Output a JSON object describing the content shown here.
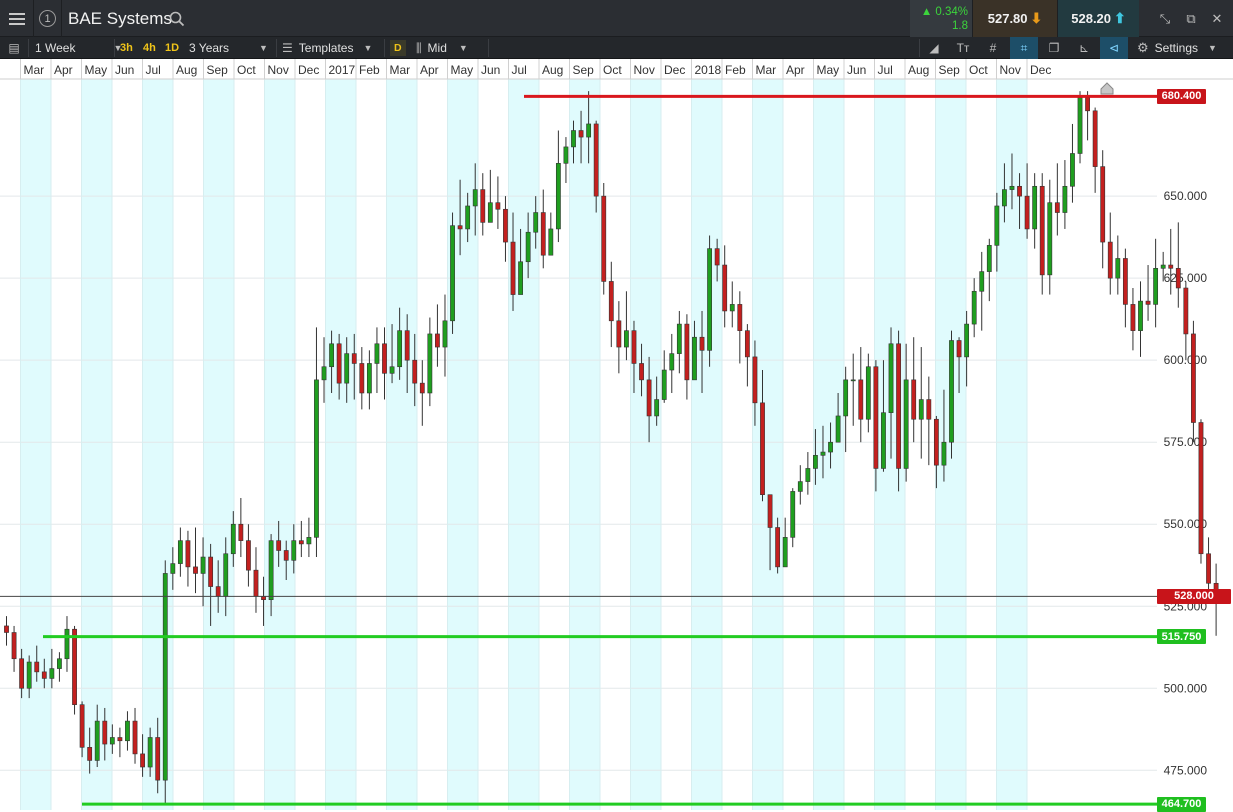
{
  "header": {
    "instrument": "BAE Systems",
    "alert_count": "1",
    "change_pct": "▲ 0.34%",
    "change_abs": "1.8",
    "sell_price": "527.80",
    "buy_price": "528.20"
  },
  "toolbar": {
    "interval": "1 Week",
    "quick_3h": "3h",
    "quick_4h": "4h",
    "quick_1d": "1D",
    "range": "3 Years",
    "templates": "Templates",
    "chart_type_badge": "D",
    "price_type": "Mid",
    "text_tool": "Tт",
    "settings": "Settings"
  },
  "chart_data": {
    "type": "candlestick",
    "x_tick_labels": [
      "Mar",
      "Apr",
      "May",
      "Jun",
      "Jul",
      "Aug",
      "Sep",
      "Oct",
      "Nov",
      "Dec",
      "2017",
      "Feb",
      "Mar",
      "Apr",
      "May",
      "Jun",
      "Jul",
      "Aug",
      "Sep",
      "Oct",
      "Nov",
      "Dec",
      "2018",
      "Feb",
      "Mar",
      "Apr",
      "May",
      "Jun",
      "Jul",
      "Aug",
      "Sep",
      "Oct",
      "Nov",
      "Dec"
    ],
    "y_tick_labels": [
      "650.000",
      "625.000",
      "600.000",
      "575.000",
      "550.000",
      "525.000",
      "500.000",
      "475.000"
    ],
    "y_ticks": [
      650,
      625,
      600,
      575,
      550,
      525,
      500,
      475
    ],
    "ylim": [
      462.9,
      685.7
    ],
    "current_price": 528.0,
    "current_price_label": "528.000",
    "horizontal_lines": [
      {
        "value": 680.4,
        "label": "680.400",
        "color": "#d9171d"
      },
      {
        "value": 515.75,
        "label": "515.750",
        "color": "#22cc22"
      },
      {
        "value": 464.7,
        "label": "464.700",
        "color": "#22cc22"
      }
    ],
    "up_color": "#1f9e1f",
    "down_color": "#c3201f",
    "candles": [
      [
        519,
        517,
        522,
        513
      ],
      [
        517,
        509,
        519,
        505
      ],
      [
        509,
        500,
        512,
        497
      ],
      [
        500,
        508,
        510,
        497
      ],
      [
        508,
        505,
        513,
        502
      ],
      [
        505,
        503,
        509,
        500
      ],
      [
        503,
        506,
        512,
        500
      ],
      [
        506,
        509,
        511,
        502
      ],
      [
        509,
        518,
        522,
        505
      ],
      [
        518,
        495,
        519,
        492
      ],
      [
        495,
        482,
        496,
        479
      ],
      [
        482,
        478,
        488,
        474
      ],
      [
        478,
        490,
        495,
        476
      ],
      [
        490,
        483,
        494,
        478
      ],
      [
        483,
        485,
        489,
        480
      ],
      [
        485,
        484,
        488,
        479
      ],
      [
        484,
        490,
        493,
        481
      ],
      [
        490,
        480,
        494,
        477
      ],
      [
        480,
        476,
        486,
        473
      ],
      [
        476,
        485,
        488,
        473
      ],
      [
        485,
        472,
        491,
        468
      ],
      [
        472,
        535,
        539,
        465
      ],
      [
        535,
        538,
        543,
        530
      ],
      [
        538,
        545,
        549,
        534
      ],
      [
        545,
        537,
        548,
        531
      ],
      [
        537,
        535,
        549,
        529
      ],
      [
        535,
        540,
        546,
        525
      ],
      [
        540,
        531,
        544,
        519
      ],
      [
        531,
        528,
        539,
        523
      ],
      [
        528,
        541,
        546,
        522
      ],
      [
        541,
        550,
        554,
        537
      ],
      [
        550,
        545,
        558,
        540
      ],
      [
        545,
        536,
        550,
        531
      ],
      [
        536,
        528,
        543,
        523
      ],
      [
        528,
        527,
        534,
        519
      ],
      [
        527,
        545,
        547,
        522
      ],
      [
        545,
        542,
        551,
        537
      ],
      [
        542,
        539,
        545,
        533
      ],
      [
        539,
        545,
        550,
        535
      ],
      [
        545,
        544,
        551,
        540
      ],
      [
        544,
        546,
        552,
        540
      ],
      [
        546,
        594,
        610,
        540
      ],
      [
        594,
        598,
        607,
        587
      ],
      [
        598,
        605,
        609,
        590
      ],
      [
        605,
        593,
        608,
        588
      ],
      [
        593,
        602,
        607,
        587
      ],
      [
        602,
        599,
        608,
        588
      ],
      [
        599,
        590,
        604,
        585
      ],
      [
        590,
        599,
        603,
        585
      ],
      [
        599,
        605,
        610,
        590
      ],
      [
        605,
        596,
        610,
        588
      ],
      [
        596,
        598,
        611,
        593
      ],
      [
        598,
        609,
        616,
        594
      ],
      [
        609,
        600,
        614,
        590
      ],
      [
        600,
        593,
        608,
        586
      ],
      [
        593,
        590,
        600,
        580
      ],
      [
        590,
        608,
        613,
        586
      ],
      [
        608,
        604,
        617,
        598
      ],
      [
        604,
        612,
        620,
        595
      ],
      [
        612,
        641,
        645,
        608
      ],
      [
        641,
        640,
        655,
        632
      ],
      [
        640,
        647,
        651,
        636
      ],
      [
        647,
        652,
        660,
        638
      ],
      [
        652,
        642,
        657,
        638
      ],
      [
        642,
        648,
        658,
        643
      ],
      [
        648,
        646,
        656,
        640
      ],
      [
        646,
        636,
        650,
        630
      ],
      [
        636,
        620,
        645,
        615
      ],
      [
        620,
        630,
        640,
        623
      ],
      [
        630,
        639,
        645,
        625
      ],
      [
        639,
        645,
        650,
        634
      ],
      [
        645,
        632,
        652,
        628
      ],
      [
        632,
        640,
        645,
        633
      ],
      [
        640,
        660,
        670,
        636
      ],
      [
        660,
        665,
        668,
        654
      ],
      [
        665,
        670,
        673,
        660
      ],
      [
        670,
        668,
        676,
        660
      ],
      [
        668,
        672,
        682,
        660
      ],
      [
        672,
        650,
        673,
        645
      ],
      [
        650,
        624,
        654,
        620
      ],
      [
        624,
        612,
        630,
        604
      ],
      [
        612,
        604,
        618,
        596
      ],
      [
        604,
        609,
        621,
        600
      ],
      [
        609,
        599,
        612,
        590
      ],
      [
        599,
        594,
        605,
        589
      ],
      [
        594,
        583,
        601,
        575
      ],
      [
        583,
        588,
        595,
        580
      ],
      [
        588,
        597,
        603,
        587
      ],
      [
        597,
        602,
        608,
        590
      ],
      [
        602,
        611,
        615,
        596
      ],
      [
        611,
        594,
        614,
        588
      ],
      [
        594,
        607,
        612,
        596
      ],
      [
        607,
        603,
        615,
        590
      ],
      [
        603,
        634,
        638,
        598
      ],
      [
        634,
        629,
        637,
        624
      ],
      [
        629,
        615,
        635,
        610
      ],
      [
        615,
        617,
        624,
        610
      ],
      [
        617,
        609,
        621,
        599
      ],
      [
        609,
        601,
        611,
        592
      ],
      [
        601,
        587,
        606,
        580
      ],
      [
        587,
        559,
        597,
        557
      ],
      [
        559,
        549,
        552,
        536
      ],
      [
        549,
        537,
        552,
        535
      ],
      [
        537,
        546,
        552,
        540
      ],
      [
        546,
        560,
        561,
        543
      ],
      [
        560,
        563,
        568,
        556
      ],
      [
        563,
        567,
        572,
        559
      ],
      [
        567,
        571,
        579,
        562
      ],
      [
        571,
        572,
        580,
        564
      ],
      [
        572,
        575,
        581,
        567
      ],
      [
        575,
        583,
        590,
        578
      ],
      [
        583,
        594,
        598,
        572
      ],
      [
        594,
        594,
        602,
        580
      ],
      [
        594,
        582,
        604,
        575
      ],
      [
        582,
        598,
        602,
        578
      ],
      [
        598,
        567,
        600,
        560
      ],
      [
        567,
        584,
        600,
        566
      ],
      [
        584,
        605,
        610,
        570
      ],
      [
        605,
        567,
        609,
        560
      ],
      [
        567,
        594,
        605,
        563
      ],
      [
        594,
        582,
        607,
        575
      ],
      [
        582,
        588,
        604,
        570
      ],
      [
        588,
        582,
        595,
        568
      ],
      [
        582,
        568,
        583,
        561
      ],
      [
        568,
        575,
        591,
        563
      ],
      [
        575,
        606,
        609,
        570
      ],
      [
        606,
        601,
        607,
        590
      ],
      [
        601,
        611,
        615,
        592
      ],
      [
        611,
        621,
        625,
        607
      ],
      [
        621,
        627,
        633,
        609
      ],
      [
        627,
        635,
        637,
        618
      ],
      [
        635,
        647,
        651,
        627
      ],
      [
        647,
        652,
        660,
        642
      ],
      [
        652,
        653,
        663,
        646
      ],
      [
        653,
        650,
        657,
        640
      ],
      [
        650,
        640,
        660,
        637
      ],
      [
        640,
        653,
        657,
        634
      ],
      [
        653,
        626,
        657,
        620
      ],
      [
        626,
        648,
        655,
        620
      ],
      [
        648,
        645,
        660,
        638
      ],
      [
        645,
        653,
        661,
        640
      ],
      [
        653,
        663,
        672,
        648
      ],
      [
        663,
        680,
        682,
        660
      ],
      [
        680,
        676,
        682,
        667
      ],
      [
        676,
        659,
        677,
        651
      ],
      [
        659,
        636,
        664,
        628
      ],
      [
        636,
        625,
        645,
        620
      ],
      [
        625,
        631,
        638,
        620
      ],
      [
        631,
        617,
        634,
        610
      ],
      [
        617,
        609,
        622,
        603
      ],
      [
        609,
        618,
        624,
        601
      ],
      [
        618,
        617,
        629,
        612
      ],
      [
        617,
        628,
        637,
        610
      ],
      [
        628,
        629,
        633,
        624
      ],
      [
        629,
        628,
        640,
        620
      ],
      [
        628,
        622,
        642,
        616
      ],
      [
        622,
        608,
        624,
        600
      ],
      [
        608,
        581,
        612,
        575
      ],
      [
        581,
        541,
        582,
        538
      ],
      [
        541,
        532,
        546,
        527
      ],
      [
        532,
        527,
        538,
        516
      ],
      [
        527,
        528,
        529,
        527
      ]
    ]
  }
}
